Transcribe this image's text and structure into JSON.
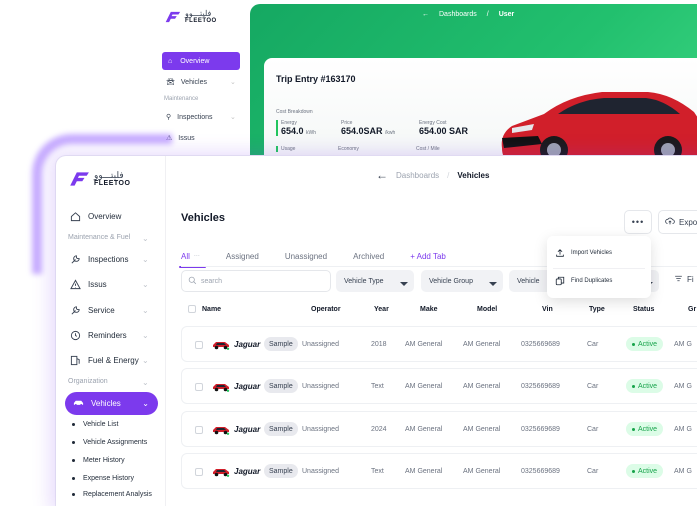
{
  "back_window": {
    "logo": {
      "arabic": "فليتـــوو",
      "english": "FLEETOO"
    },
    "nav": {
      "overview": "Overview",
      "vehicles": "Vehicles",
      "section_maintenance": "Maintenance",
      "inspections": "Inspections",
      "issues": "Issus"
    },
    "breadcrumb": {
      "parent": "Dashboards",
      "separator": "/",
      "current": "User"
    },
    "trip": {
      "title": "Trip Entry #163170",
      "cost_breakdown_label": "Cost Breakdown",
      "energy_label": "Energy",
      "energy_value": "654.0",
      "energy_unit": "kWh",
      "price_label": "Price",
      "price_value": "654.0SAR",
      "price_unit": "/kwh",
      "energy_cost_label": "Energy Cost",
      "energy_cost_value": "654.00 SAR",
      "usage_label": "Usage",
      "economy_label": "Economy",
      "cost_mile_label": "Cost / Mile"
    }
  },
  "sidebar": {
    "logo": {
      "arabic": "فليتـــوو",
      "english": "FLEETOO"
    },
    "overview": "Overview",
    "section_maintenance": "Maintenance & Fuel",
    "inspections": "Inspections",
    "issues": "Issus",
    "service": "Service",
    "reminders": "Reminders",
    "fuel_energy": "Fuel & Energy",
    "section_organization": "Organization",
    "vehicles": "Vehicles",
    "sub_items": [
      "Vehicle List",
      "Vehicle Assignments",
      "Meter History",
      "Expense History",
      "Replacement Analysis"
    ]
  },
  "header": {
    "back_arrow": "←",
    "crumb_parent": "Dashboards",
    "separator": "/",
    "crumb_current": "Vehicles"
  },
  "page": {
    "title": "Vehicles",
    "more_label": "•••",
    "export_label": "Expo"
  },
  "tabs": {
    "all": "All",
    "all_dots": "···",
    "assigned": "Assigned",
    "unassigned": "Unassigned",
    "archived": "Archived",
    "add_tab": "+ Add Tab"
  },
  "filters": {
    "search_placeholder": "search",
    "vehicle_type": "Vehicle Type",
    "vehicle_group": "Vehicle Group",
    "vehicle_status": "Vehicle",
    "filters_label": "Fi"
  },
  "menu": {
    "import": "Import Vehicles",
    "duplicates": "Find Duplicates"
  },
  "table": {
    "headers": {
      "name": "Name",
      "operator": "Operator",
      "year": "Year",
      "make": "Make",
      "model": "Model",
      "vin": "Vin",
      "type": "Type",
      "status": "Status",
      "group": "Gr"
    },
    "rows": [
      {
        "name": "Jaguar",
        "badge": "Sample",
        "operator": "Unassigned",
        "year": "2018",
        "make": "AM General",
        "model": "AM General",
        "vin": "0325669689",
        "type": "Car",
        "status": "Active",
        "group": "AM G"
      },
      {
        "name": "Jaguar",
        "badge": "Sample",
        "operator": "Unassigned",
        "year": "Text",
        "make": "AM General",
        "model": "AM General",
        "vin": "0325669689",
        "type": "Car",
        "status": "Active",
        "group": "AM G"
      },
      {
        "name": "Jaguar",
        "badge": "Sample",
        "operator": "Unassigned",
        "year": "2024",
        "make": "AM General",
        "model": "AM General",
        "vin": "0325669689",
        "type": "Car",
        "status": "Active",
        "group": "AM G"
      },
      {
        "name": "Jaguar",
        "badge": "Sample",
        "operator": "Unassigned",
        "year": "Text",
        "make": "AM General",
        "model": "AM General",
        "vin": "0325669689",
        "type": "Car",
        "status": "Active",
        "group": "AM G"
      }
    ]
  },
  "colors": {
    "accent": "#7c3aed",
    "green": "#22c06e",
    "active_text": "#16a34a",
    "active_bg": "#dcfce7",
    "car_red": "#d11f2a"
  },
  "icons": [
    "home-icon",
    "car-icon",
    "wrench-icon",
    "warning-icon",
    "service-icon",
    "clock-icon",
    "fuel-icon",
    "upload-icon",
    "duplicate-icon",
    "search-icon",
    "filter-icon",
    "cloud-upload-icon",
    "arrow-left-icon"
  ]
}
